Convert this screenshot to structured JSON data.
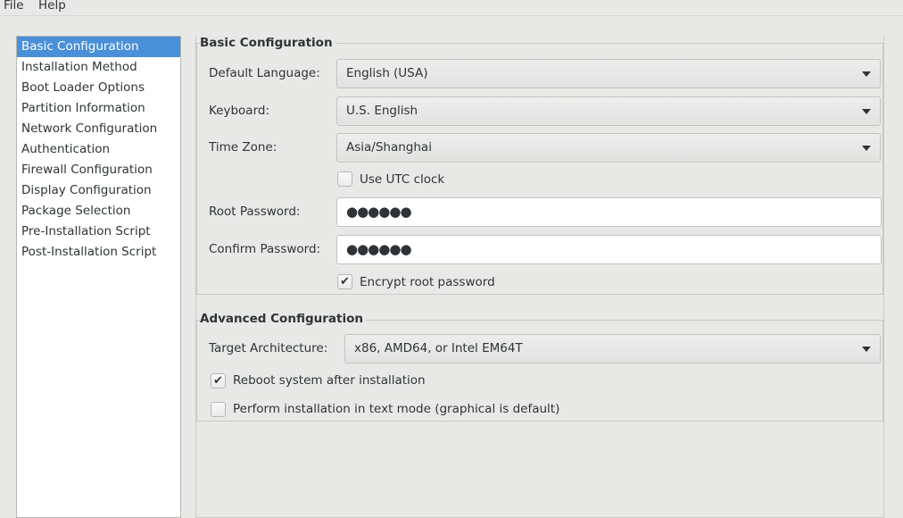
{
  "menubar": {
    "items": [
      "File",
      "Help"
    ]
  },
  "sidebar": {
    "items": [
      {
        "label": "Basic Configuration",
        "selected": true
      },
      {
        "label": "Installation Method"
      },
      {
        "label": "Boot Loader Options"
      },
      {
        "label": "Partition Information"
      },
      {
        "label": "Network Configuration"
      },
      {
        "label": "Authentication"
      },
      {
        "label": "Firewall Configuration"
      },
      {
        "label": "Display Configuration"
      },
      {
        "label": "Package Selection"
      },
      {
        "label": "Pre-Installation Script"
      },
      {
        "label": "Post-Installation Script"
      }
    ]
  },
  "basic": {
    "title": "Basic Configuration",
    "language_label": "Default Language:",
    "language_value": "English (USA)",
    "keyboard_label": "Keyboard:",
    "keyboard_value": "U.S. English",
    "timezone_label": "Time Zone:",
    "timezone_value": "Asia/Shanghai",
    "utc_label": "Use UTC clock",
    "utc_checked": false,
    "root_label": "Root Password:",
    "root_value": "●●●●●●",
    "confirm_label": "Confirm Password:",
    "confirm_value": "●●●●●●",
    "encrypt_label": "Encrypt root password",
    "encrypt_checked": true
  },
  "advanced": {
    "title": "Advanced Configuration",
    "arch_label": "Target Architecture:",
    "arch_value": "x86, AMD64, or Intel EM64T",
    "reboot_label": "Reboot system after installation",
    "reboot_checked": true,
    "textmode_label": "Perform installation in text mode (graphical is default)",
    "textmode_checked": false
  },
  "colors": {
    "selection": "#4a90d9"
  }
}
